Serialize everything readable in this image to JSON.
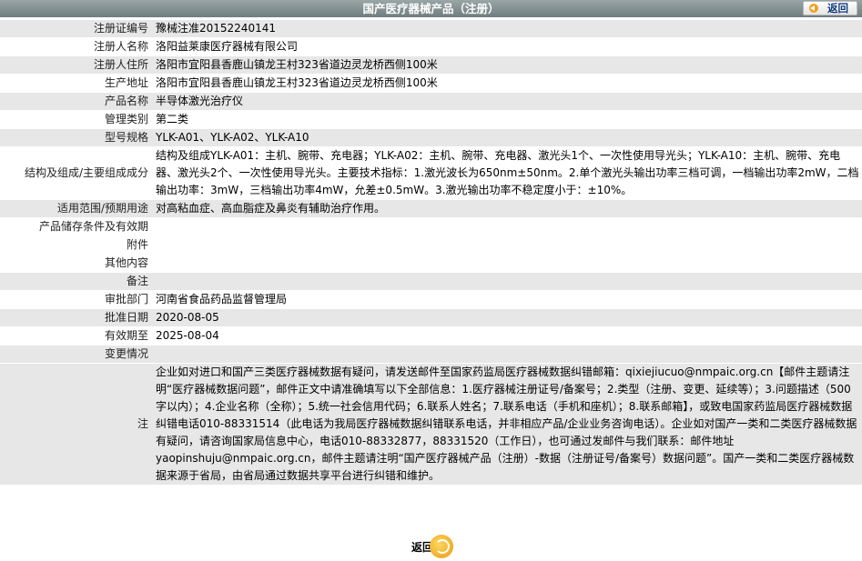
{
  "header": {
    "title": "国产医疗器械产品（注册）",
    "back_label": "返回"
  },
  "fields": [
    {
      "label": "注册证编号",
      "value": "豫械注准20152240141"
    },
    {
      "label": "注册人名称",
      "value": "洛阳益莱康医疗器械有限公司"
    },
    {
      "label": "注册人住所",
      "value": "洛阳市宜阳县香鹿山镇龙王村323省道边灵龙桥西侧100米"
    },
    {
      "label": "生产地址",
      "value": "洛阳市宜阳县香鹿山镇龙王村323省道边灵龙桥西侧100米"
    },
    {
      "label": "产品名称",
      "value": "半导体激光治疗仪"
    },
    {
      "label": "管理类别",
      "value": "第二类"
    },
    {
      "label": "型号规格",
      "value": "YLK-A01、YLK-A02、YLK-A10"
    },
    {
      "label": "结构及组成/主要组成成分",
      "value": "结构及组成YLK-A01：主机、腕带、充电器；YLK-A02：主机、腕带、充电器、激光头1个、一次性使用导光头；YLK-A10：主机、腕带、充电器、激光头2个、一次性使用导光头。主要技术指标：1.激光波长为650nm±50nm。2.单个激光头输出功率三档可调，一档输出功率2mW，二档输出功率：3mW，三档输出功率4mW，允差±0.5mW。3.激光输出功率不稳定度小于：±10%。"
    },
    {
      "label": "适用范围/预期用途",
      "value": "对高粘血症、高血脂症及鼻炎有辅助治疗作用。"
    },
    {
      "label": "产品储存条件及有效期",
      "value": ""
    },
    {
      "label": "附件",
      "value": ""
    },
    {
      "label": "其他内容",
      "value": ""
    },
    {
      "label": "备注",
      "value": ""
    },
    {
      "label": "审批部门",
      "value": "河南省食品药品监督管理局"
    },
    {
      "label": "批准日期",
      "value": "2020-08-05"
    },
    {
      "label": "有效期至",
      "value": "2025-08-04"
    },
    {
      "label": "变更情况",
      "value": ""
    }
  ],
  "note": {
    "label": "注",
    "text": "企业如对进口和国产三类医疗器械数据有疑问，请发送邮件至国家药监局医疗器械数据纠错邮箱：qixiejiucuo@nmpaic.org.cn【邮件主题请注明“医疗器械数据问题”，邮件正文中请准确填写以下全部信息：1.医疗器械注册证号/备案号；2.类型（注册、变更、延续等）；3.问题描述（500字以内）；4.企业名称（全称）；5.统一社会信用代码；6.联系人姓名；7.联系电话（手机和座机）；8.联系邮箱】，或致电国家药监局医疗器械数据纠错电话010-88331514（此电话为我局医疗器械数据纠错联系电话，并非相应产品/企业业务咨询电话）。企业如对国产一类和二类医疗器械数据有疑问，请咨询国家局信息中心，电话010-88332877，88331520（工作日），也可通过发邮件与我们联系：邮件地址yaopinshuju@nmpaic.org.cn，邮件主题请注明“国产医疗器械产品（注册）-数据（注册证号/备案号）数据问题”。国产一类和二类医疗器械数据来源于省局，由省局通过数据共享平台进行纠错和维护。"
  },
  "footer": {
    "back_label": "返回"
  }
}
